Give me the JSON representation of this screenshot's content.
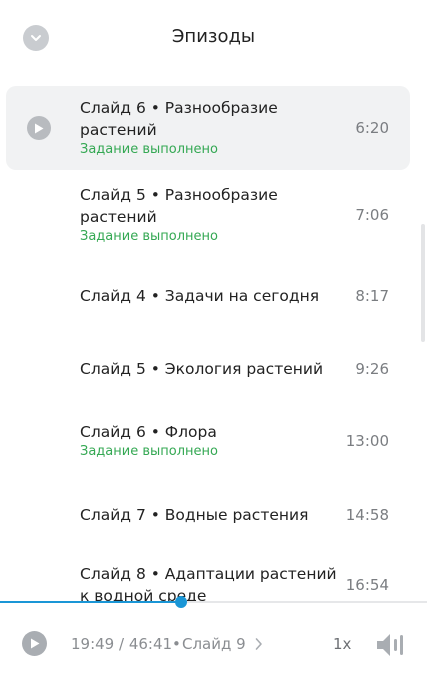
{
  "header": {
    "title": "Эпизоды",
    "collapse_icon": "chevron-down-icon"
  },
  "episodes": [
    {
      "name": "Слайд 6 • Разнообразие растений",
      "status": "Задание выполнено",
      "duration": "6:20",
      "active": true
    },
    {
      "name": "Слайд 5 • Разнообразие растений",
      "status": "Задание выполнено",
      "duration": "7:06",
      "active": false
    },
    {
      "name": "Слайд 4 • Задачи на сегодня",
      "status": "",
      "duration": "8:17",
      "active": false
    },
    {
      "name": "Слайд 5 • Экология растений",
      "status": "",
      "duration": "9:26",
      "active": false
    },
    {
      "name": "Слайд 6 • Флора",
      "status": "Задание выполнено",
      "duration": "13:00",
      "active": false
    },
    {
      "name": "Слайд 7 • Водные растения",
      "status": "",
      "duration": "14:58",
      "active": false
    },
    {
      "name": "Слайд 8 • Адаптации растений к водной среде",
      "status": "",
      "duration": "16:54",
      "active": false
    }
  ],
  "player": {
    "time": "19:49 / 46:41",
    "separator": "•",
    "next_slide": "Слайд 9",
    "speed": "1x",
    "progress_fraction": 0.424,
    "play_icon": "play-icon",
    "volume_icon": "volume-icon"
  },
  "colors": {
    "accent": "#1a96d6",
    "done": "#34a853",
    "active_bg": "#f1f2f3"
  }
}
